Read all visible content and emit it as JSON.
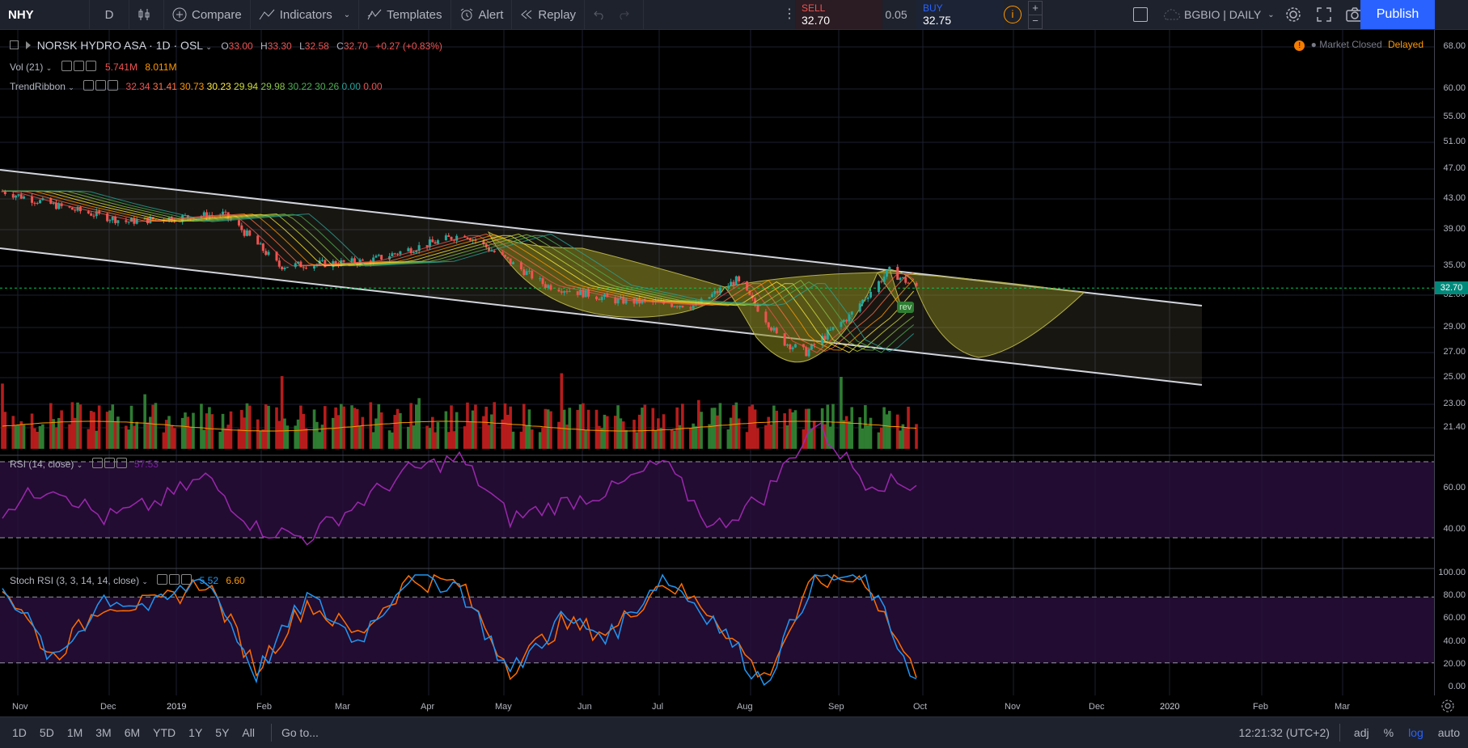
{
  "toolbar": {
    "symbol": "NHY",
    "interval": "D",
    "compare": "Compare",
    "indicators": "Indicators",
    "templates": "Templates",
    "alert": "Alert",
    "replay": "Replay",
    "sell_label": "SELL",
    "sell_price": "32.70",
    "spread": "0.05",
    "buy_label": "BUY",
    "buy_price": "32.75",
    "layout_name": "BGBIO | DAILY",
    "publish": "Publish"
  },
  "legend": {
    "title": "NORSK HYDRO ASA · 1D · OSL",
    "o_label": "O",
    "o": "33.00",
    "h_label": "H",
    "h": "33.30",
    "l_label": "L",
    "l": "32.58",
    "c_label": "C",
    "c": "32.70",
    "change": "+0.27 (+0.83%)",
    "vol_name": "Vol (21)",
    "vol_a": "5.741M",
    "vol_b": "8.011M",
    "trend_name": "TrendRibbon",
    "trend_values": [
      "32.34",
      "31.41",
      "30.73",
      "30.23",
      "29.94",
      "29.98",
      "30.22",
      "30.26",
      "0.00",
      "0.00"
    ],
    "market_status": "Market Closed",
    "delayed": "Delayed",
    "rsi_name": "RSI (14, close)",
    "rsi_value": "57.53",
    "stoch_name": "Stoch RSI (3, 3, 14, 14, close)",
    "stoch_k": "5.52",
    "stoch_d": "6.60",
    "rev_label": "rev"
  },
  "price_axis": [
    "68.00",
    "60.00",
    "55.00",
    "51.00",
    "47.00",
    "43.00",
    "39.00",
    "35.00",
    "32.00",
    "29.00",
    "27.00",
    "25.00",
    "23.00",
    "21.40"
  ],
  "last_price": "32.70",
  "rsi_axis": [
    "60.00",
    "40.00"
  ],
  "stoch_axis": [
    "100.00",
    "80.00",
    "60.00",
    "40.00",
    "20.00",
    "0.00"
  ],
  "time_axis": [
    "Nov",
    "Dec",
    "2019",
    "Feb",
    "Mar",
    "Apr",
    "May",
    "Jun",
    "Jul",
    "Aug",
    "Sep",
    "Oct",
    "Nov",
    "Dec",
    "2020",
    "Feb",
    "Mar"
  ],
  "bottom": {
    "ranges": [
      "1D",
      "5D",
      "1M",
      "3M",
      "6M",
      "YTD",
      "1Y",
      "5Y",
      "All"
    ],
    "goto": "Go to...",
    "clock": "12:21:32 (UTC+2)",
    "adj": "adj",
    "pct": "%",
    "log": "log",
    "auto": "auto"
  },
  "colors": {
    "up": "#26a69a",
    "down": "#ef5350",
    "rsi": "#9c27b0",
    "stoch_k": "#2196f3",
    "stoch_d": "#ff6d00",
    "accent": "#2962ff",
    "pattern_fill": "#8c8a1e"
  },
  "chart_data": [
    {
      "type": "candlestick",
      "title": "NORSK HYDRO ASA · 1D · OSL",
      "x_period": [
        "2018-10-25",
        "2019-09-30"
      ],
      "close_path": [
        {
          "date": "2018-10-25",
          "close": 44.0
        },
        {
          "date": "2018-11-15",
          "close": 42.0
        },
        {
          "date": "2018-12-10",
          "close": 40.0
        },
        {
          "date": "2019-01-15",
          "close": 41.0
        },
        {
          "date": "2019-02-05",
          "close": 35.0
        },
        {
          "date": "2019-03-10",
          "close": 35.5
        },
        {
          "date": "2019-04-15",
          "close": 38.5
        },
        {
          "date": "2019-05-15",
          "close": 33.0
        },
        {
          "date": "2019-06-10",
          "close": 31.5
        },
        {
          "date": "2019-07-10",
          "close": 31.0
        },
        {
          "date": "2019-07-25",
          "close": 33.5
        },
        {
          "date": "2019-08-10",
          "close": 28.0
        },
        {
          "date": "2019-08-20",
          "close": 27.0
        },
        {
          "date": "2019-09-05",
          "close": 30.0
        },
        {
          "date": "2019-09-20",
          "close": 34.5
        },
        {
          "date": "2019-09-30",
          "close": 32.7
        }
      ],
      "last": 32.7,
      "ylim": [
        21.4,
        68.0
      ],
      "scale": "log"
    },
    {
      "type": "line",
      "name": "RSI (14, close)",
      "series": [
        {
          "name": "RSI",
          "values": [
            45,
            58,
            40,
            48,
            62,
            35,
            30,
            48,
            65,
            72,
            40,
            48,
            55,
            70,
            35,
            52,
            90,
            60,
            57.53
          ]
        }
      ],
      "bands": [
        30,
        70
      ]
    },
    {
      "type": "line",
      "name": "Stoch RSI (3, 3, 14, 14, close)",
      "series": [
        {
          "name": "K",
          "values": [
            95,
            20,
            80,
            70,
            100,
            10,
            80,
            40,
            100,
            90,
            10,
            60,
            45,
            100,
            60,
            0,
            100,
            95,
            5.52
          ]
        },
        {
          "name": "D",
          "values": [
            90,
            25,
            75,
            72,
            95,
            15,
            75,
            45,
            95,
            92,
            15,
            55,
            48,
            95,
            65,
            5,
            95,
            97,
            6.6
          ]
        }
      ],
      "bands": [
        20,
        80
      ]
    }
  ]
}
